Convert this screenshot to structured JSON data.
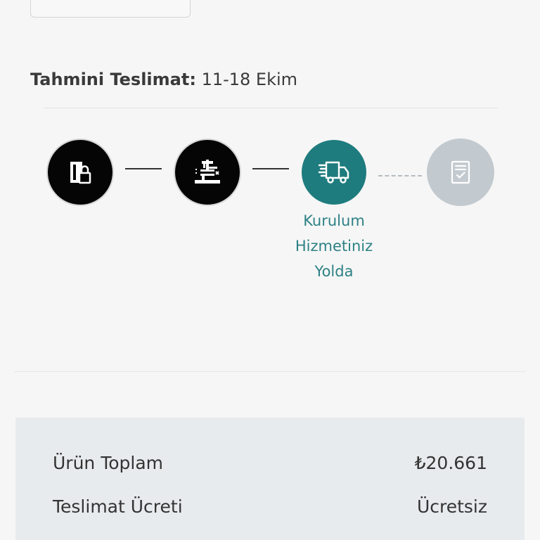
{
  "delivery": {
    "label": "Tahmini Teslimat:",
    "value": " 11-18 Ekim"
  },
  "tracker": {
    "steps": [
      {
        "name": "order-confirmed",
        "icon": "door-lock-icon",
        "status": "done"
      },
      {
        "name": "preparing",
        "icon": "workbench-tools-icon",
        "status": "done"
      },
      {
        "name": "shipping",
        "icon": "delivery-truck-icon",
        "status": "active"
      },
      {
        "name": "completed",
        "icon": "checklist-document-icon",
        "status": "pending"
      }
    ],
    "active_caption": [
      "Kurulum",
      "Hizmetiniz",
      "Yolda"
    ],
    "colors": {
      "done": "#050505",
      "active": "#1f7c7e",
      "pending": "#c3cacf",
      "caption": "#2d8185"
    }
  },
  "summary": {
    "rows": [
      {
        "label": "Ürün Toplam",
        "value": "₺20.661"
      },
      {
        "label": "Teslimat Ücreti",
        "value": "Ücretsiz"
      }
    ]
  }
}
